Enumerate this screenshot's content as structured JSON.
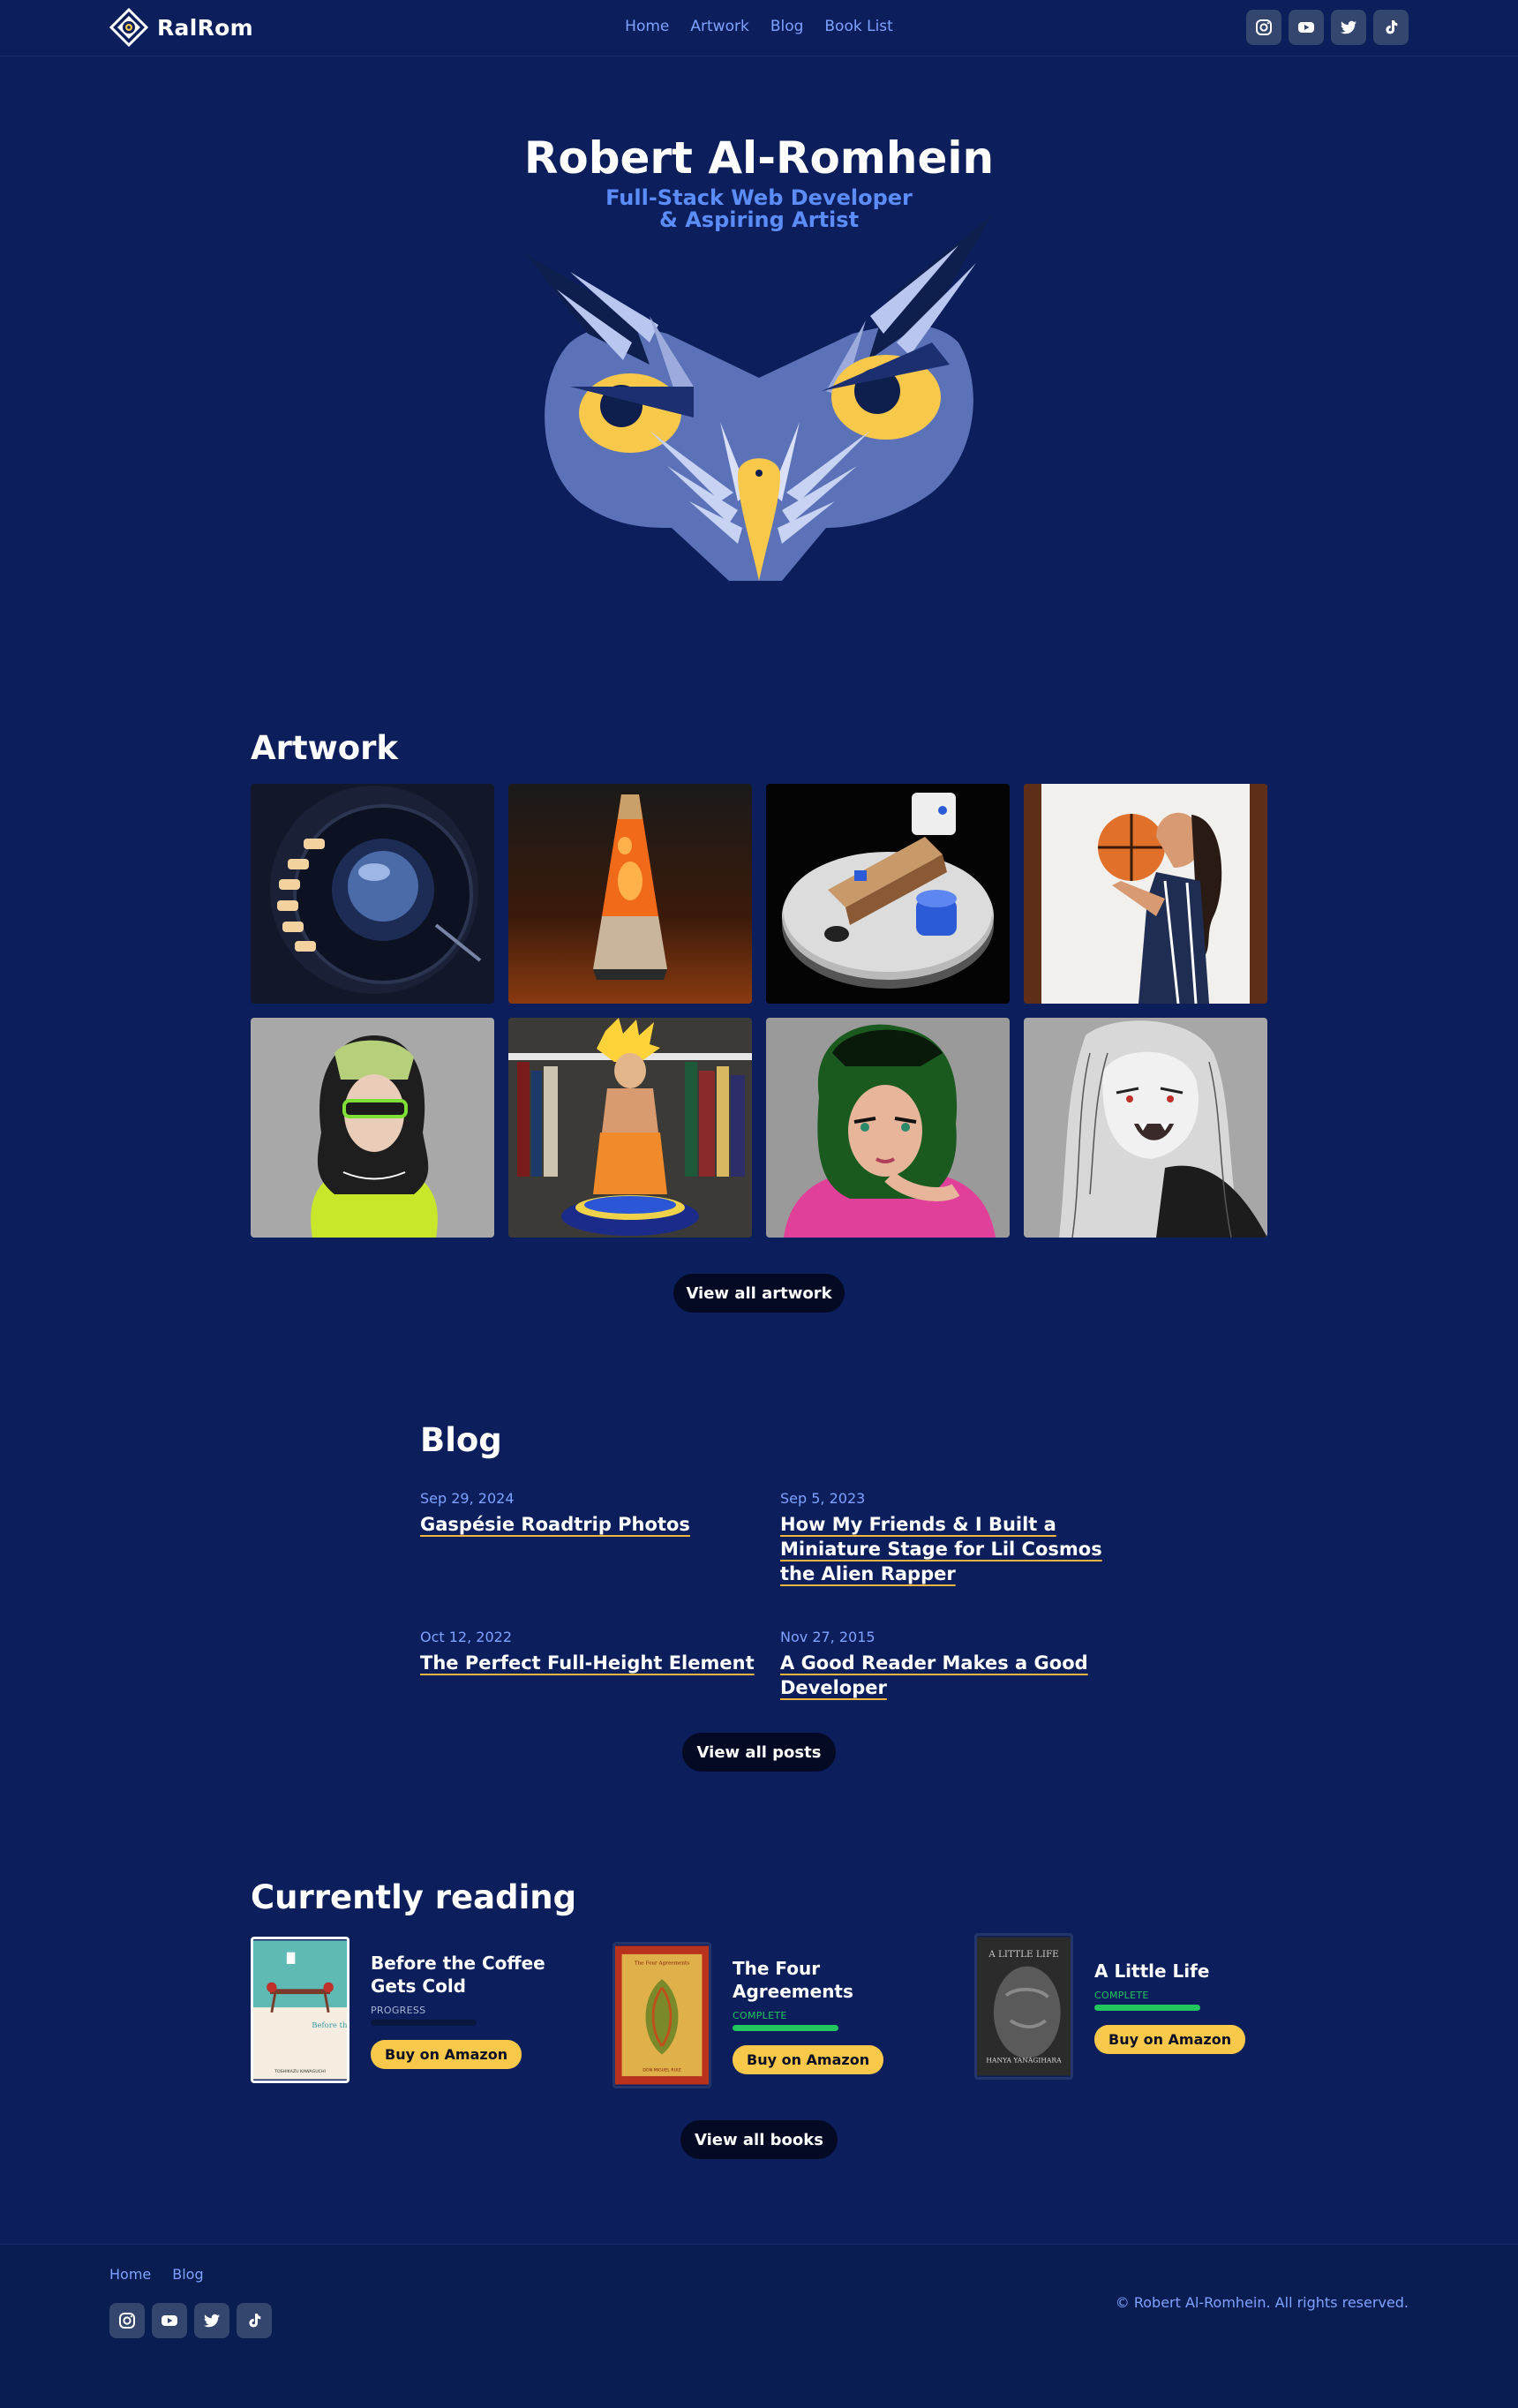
{
  "header": {
    "brand": "RalRom",
    "nav": [
      "Home",
      "Artwork",
      "Blog",
      "Book List"
    ],
    "socials": [
      "instagram-icon",
      "youtube-icon",
      "twitter-icon",
      "tiktok-icon"
    ]
  },
  "hero": {
    "name": "Robert Al-Romhein",
    "subtitle_line1": "Full-Stack Web Developer",
    "subtitle_line2": "& Aspiring Artist"
  },
  "artwork": {
    "title": "Artwork",
    "view_all": "View all artwork"
  },
  "blog": {
    "title": "Blog",
    "posts": [
      {
        "date": "Sep 29, 2024",
        "title": "Gaspésie Roadtrip Photos"
      },
      {
        "date": "Sep 5, 2023",
        "title": "How My Friends & I Built a Miniature Stage for Lil Cosmos the Alien Rapper"
      },
      {
        "date": "Oct 12, 2022",
        "title": "The Perfect Full-Height Element"
      },
      {
        "date": "Nov 27, 2015",
        "title": "A Good Reader Makes a Good Developer"
      }
    ],
    "view_all": "View all posts"
  },
  "reading": {
    "title": "Currently reading",
    "books": [
      {
        "title": "Before the Coffee Gets Cold",
        "status": "PROGRESS",
        "progress": 0,
        "buy": "Buy on Amazon",
        "cover_text": "Before the coffee gets cold",
        "cover_author": "TOSHIKAZU KAWAGUCHI"
      },
      {
        "title": "The Four Agreements",
        "status": "COMPLETE",
        "progress": 1,
        "buy": "Buy on Amazon",
        "cover_text": "The Four Agreements",
        "cover_author": "DON MIGUEL RUIZ"
      },
      {
        "title": "A Little Life",
        "status": "COMPLETE",
        "progress": 1,
        "buy": "Buy on Amazon",
        "cover_text": "A LITTLE LIFE",
        "cover_author": "HANYA YANAGIHARA"
      }
    ],
    "view_all": "View all books"
  },
  "footer": {
    "nav": [
      "Home",
      "Blog"
    ],
    "copyright": "© Robert Al-Romhein. All rights reserved."
  },
  "colors": {
    "background": "#0c1f5c",
    "accent_blue": "#7ea2ff",
    "button_yellow": "#f8c84b",
    "progress_green": "#22c55e"
  }
}
